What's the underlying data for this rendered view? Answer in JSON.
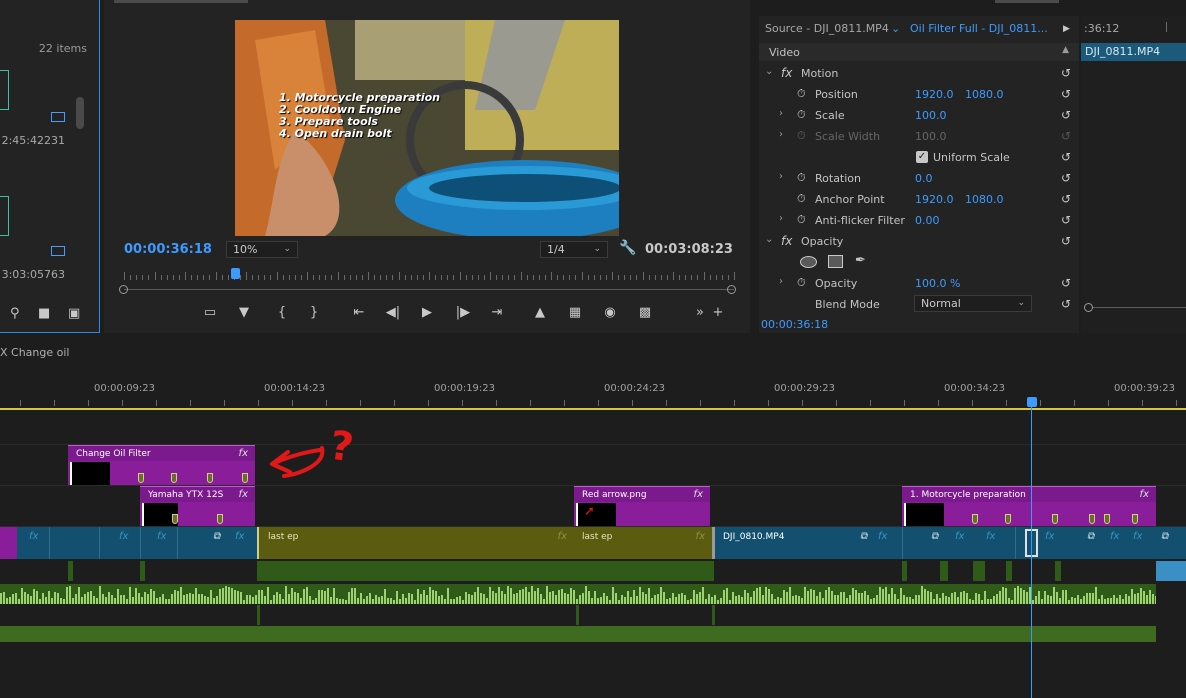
{
  "project": {
    "item_count": "22 items",
    "durations": [
      "2:45:42231",
      "3:03:05763"
    ]
  },
  "program": {
    "current_time": "00:00:36:18",
    "zoom": "10%",
    "resolution": "1/4",
    "duration": "00:03:08:23",
    "overlay_lines": [
      "1. Motorcycle preparation",
      "2. Cooldown Engine",
      "3. Prepare tools",
      "4. Open drain bolt"
    ]
  },
  "effect_controls": {
    "source_tab": "Source - DJI_0811.MP4",
    "clip_tab": "Oil Filter Full - DJI_0811...",
    "section": "Video",
    "motion_label": "Motion",
    "position": {
      "label": "Position",
      "x": "1920.0",
      "y": "1080.0"
    },
    "scale": {
      "label": "Scale",
      "value": "100.0"
    },
    "scale_width": {
      "label": "Scale Width",
      "value": "100.0"
    },
    "uniform_scale": "Uniform Scale",
    "rotation": {
      "label": "Rotation",
      "value": "0.0"
    },
    "anchor_point": {
      "label": "Anchor Point",
      "x": "1920.0",
      "y": "1080.0"
    },
    "anti_flicker": {
      "label": "Anti-flicker Filter",
      "value": "0.00"
    },
    "opacity_label": "Opacity",
    "opacity": {
      "label": "Opacity",
      "value": "100.0 %"
    },
    "blend_mode": {
      "label": "Blend Mode",
      "value": "Normal"
    },
    "timecode": "00:00:36:18"
  },
  "mini_timeline": {
    "time": ":36:12",
    "clip": "DJI_0811.MP4"
  },
  "timeline": {
    "sequence_name": "X Change oil",
    "ruler": [
      "00:00:09:23",
      "00:00:14:23",
      "00:00:19:23",
      "00:00:24:23",
      "00:00:29:23",
      "00:00:34:23",
      "00:00:39:23"
    ],
    "clips": {
      "change_oil_filter": "Change Oil Filter",
      "yamaha": "Yamaha YTX 12S",
      "red_arrow": "Red arrow.png",
      "motorcycle_prep": "1. Motorcycle preparation",
      "last_ep_1": "last ep",
      "last_ep_2": "last ep",
      "dji_0810": "DJI_0810.MP4"
    },
    "fx_label": "fx"
  },
  "annotation": {
    "symbol": "?",
    "color": "#e01818"
  },
  "colors": {
    "accent_blue": "#3d9bff",
    "playhead_yellow": "#d7c73a",
    "graphic_clip": "#8a1d9a",
    "video_clip": "#13506f",
    "olive_clip": "#5c5c10"
  }
}
